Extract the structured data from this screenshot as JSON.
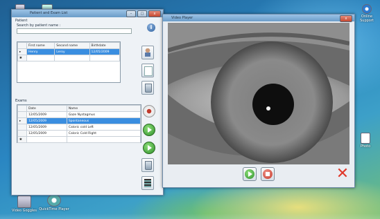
{
  "main_window": {
    "title": "Patient and Exam List",
    "min": "–",
    "max": "□",
    "close": "x",
    "patient_group_label": "Patient",
    "search_label": "Search by patient name :",
    "search_value": "",
    "patient_columns": [
      "First name",
      "Second name",
      "Birthdate"
    ],
    "patients": [
      {
        "first": "Henry",
        "second": "Leroy",
        "birth": "12/05/2009",
        "selected": true
      },
      {
        "first": "",
        "second": "",
        "birth": "",
        "selected": false
      }
    ],
    "exams_group_label": "Exams",
    "exam_columns": [
      "Date",
      "Name"
    ],
    "exams": [
      {
        "date": "12/05/2009",
        "name": "Gaze Nystagmus",
        "selected": false
      },
      {
        "date": "12/05/2009",
        "name": "Spontaneous",
        "selected": true
      },
      {
        "date": "12/05/2009",
        "name": "Caloric cold Left",
        "selected": false
      },
      {
        "date": "12/05/2009",
        "name": "Caloric Cold Right",
        "selected": false
      },
      {
        "date": "",
        "name": "",
        "selected": false
      }
    ]
  },
  "video_window": {
    "title": "Video Player",
    "close": "x"
  },
  "desktop": {
    "icons": [
      {
        "label": "Video Goggles"
      },
      {
        "label": "QuickTime Player"
      }
    ],
    "right_icon_label": "Photo",
    "top_right_label": "Online Support"
  },
  "colors": {
    "selection": "#3a8ee0",
    "titlebar": "#6b9cc8",
    "play_green": "#2d8f2a",
    "stop_red": "#d84a3a"
  }
}
